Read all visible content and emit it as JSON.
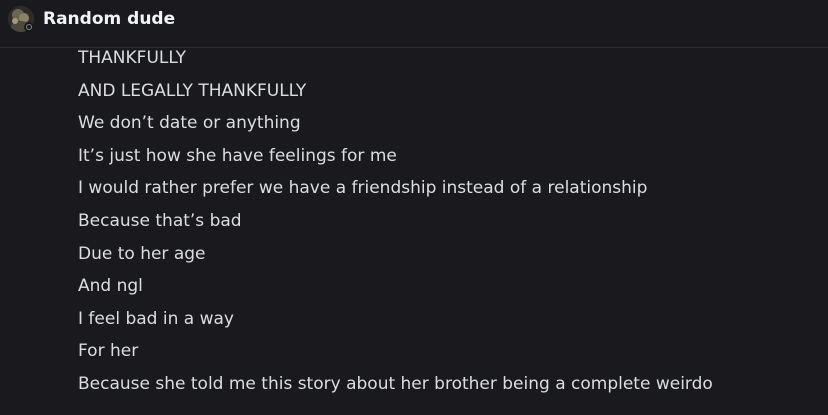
{
  "header": {
    "username": "Random dude",
    "status": "offline",
    "status_color": "#80848e"
  },
  "messages": [
    "THANKFULLY",
    "AND LEGALLY THANKFULLY",
    "We don’t date or anything",
    "It’s just how she have feelings for me",
    "I would rather prefer we have a friendship instead of a relationship",
    "Because that’s bad",
    "Due to her age",
    "And ngl",
    "I feel bad in a way",
    "For her",
    "Because she told me this story about her brother being a complete weirdo"
  ]
}
